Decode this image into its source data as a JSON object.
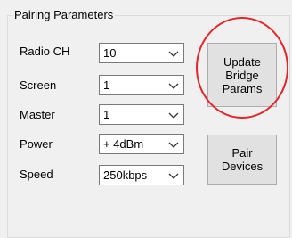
{
  "group": {
    "title": "Pairing Parameters"
  },
  "rows": [
    {
      "label": "Radio CH",
      "value": "10"
    },
    {
      "label": "Screen",
      "value": "1"
    },
    {
      "label": "Master",
      "value": "1"
    },
    {
      "label": "Power",
      "value": "+ 4dBm"
    },
    {
      "label": "Speed",
      "value": "250kbps"
    }
  ],
  "buttons": {
    "update_lines": [
      "Update",
      "Bridge",
      "Params"
    ],
    "pair_lines": [
      "Pair",
      "Devices"
    ]
  },
  "icons": {
    "dropdown": "chevron-down-icon"
  },
  "colors": {
    "highlight_circle": "#e3262a"
  }
}
